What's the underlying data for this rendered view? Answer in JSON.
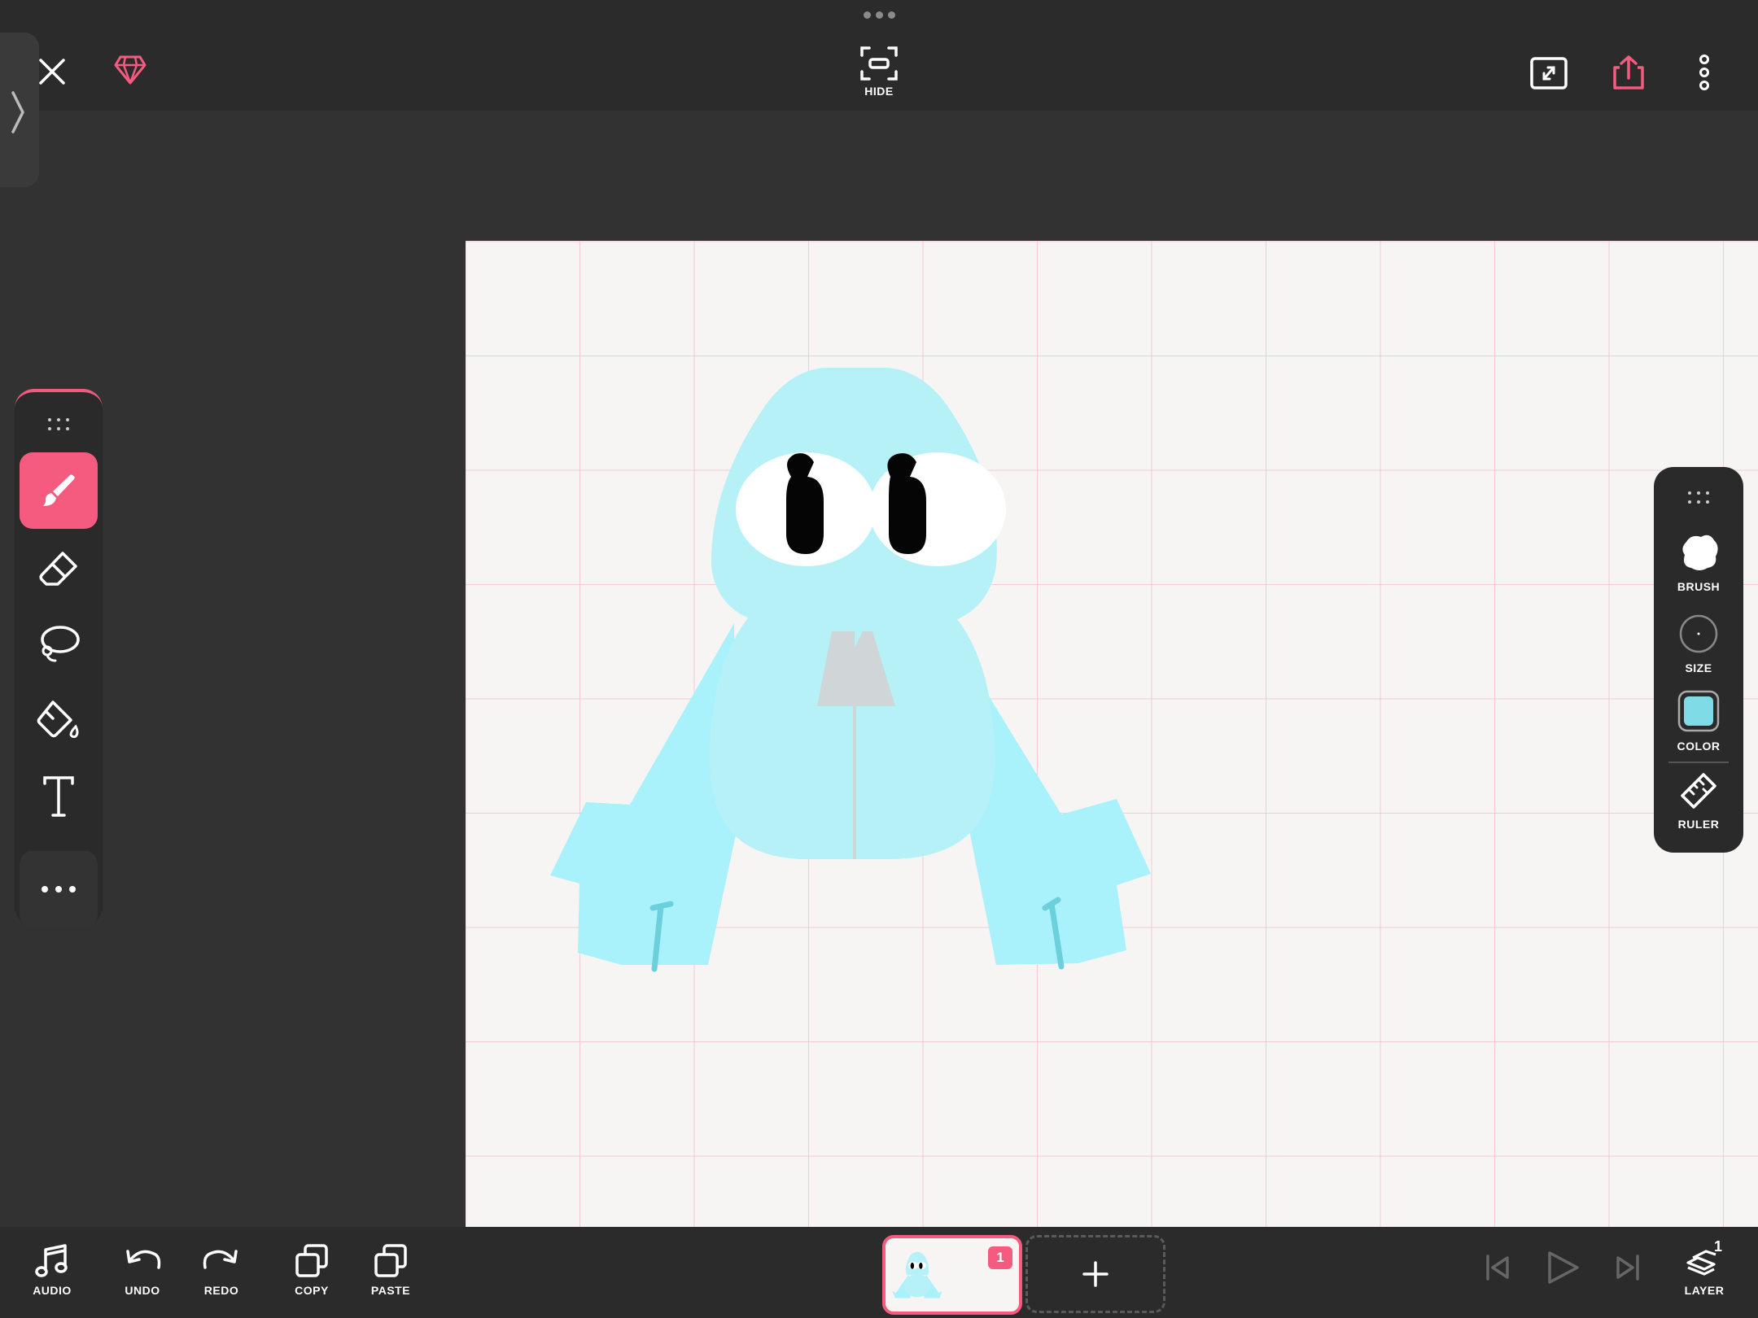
{
  "app": {
    "top": {
      "hide_label": "HIDE"
    },
    "tools": [
      {
        "name": "brush",
        "active": true
      },
      {
        "name": "eraser",
        "active": false
      },
      {
        "name": "lasso",
        "active": false
      },
      {
        "name": "fill",
        "active": false
      },
      {
        "name": "text",
        "active": false
      },
      {
        "name": "more",
        "active": false
      }
    ],
    "right_panel": {
      "brush_label": "BRUSH",
      "size_label": "SIZE",
      "color_label": "COLOR",
      "ruler_label": "RULER",
      "current_color": "#7fdbe6"
    },
    "bottom": {
      "audio_label": "AUDIO",
      "undo_label": "UNDO",
      "redo_label": "REDO",
      "copy_label": "COPY",
      "paste_label": "PASTE",
      "frame_number": "1",
      "layer_label": "LAYER",
      "layer_count": "1"
    },
    "colors": {
      "accent": "#f55b7e",
      "toolbar_bg": "#2a2a2a",
      "app_bg": "#333232",
      "canvas_bg": "#f6f5f3",
      "grid": "#f0aabe",
      "drawing_fill": "#a9f1fb"
    }
  }
}
